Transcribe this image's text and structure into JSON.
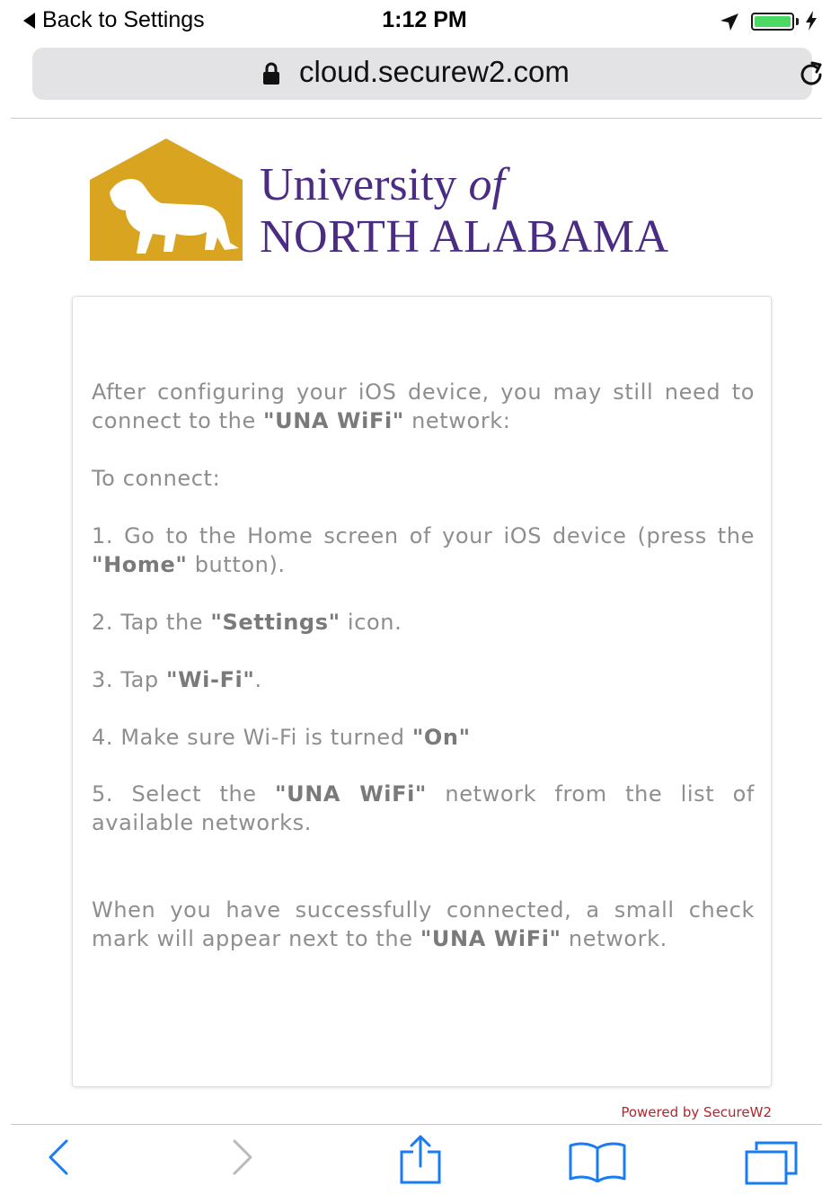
{
  "status_bar": {
    "back_label": "Back to Settings",
    "time": "1:12 PM",
    "battery_color": "#4cd964"
  },
  "browser": {
    "url": "cloud.securew2.com",
    "icons": [
      "lock-icon",
      "reload-icon",
      "back-icon",
      "forward-icon",
      "share-icon",
      "bookmarks-icon",
      "tabs-icon"
    ],
    "accent": "#1a7cf5"
  },
  "logo": {
    "line1_a": "University ",
    "line1_b": "of",
    "line2": "NORTH ALABAMA",
    "brand_gold": "#d9a521",
    "brand_purple": "#4b2c84"
  },
  "card": {
    "intro": {
      "pre": "After configuring your iOS device, you may still need to connect to the ",
      "bold": "\"UNA WiFi\"",
      "post": " network:"
    },
    "to_connect": "To connect:",
    "step1": {
      "pre": "1. Go to the Home screen of your iOS device (press the ",
      "bold": "\"Home\"",
      "post": " button)."
    },
    "step2": {
      "pre": "2. Tap the ",
      "bold": "\"Settings\"",
      "post": " icon."
    },
    "step3": {
      "pre": "3. Tap ",
      "bold": "\"Wi-Fi\"",
      "post": "."
    },
    "step4": {
      "pre": "4. Make sure Wi-Fi is turned ",
      "bold": "\"On\"",
      "post": ""
    },
    "step5": {
      "pre": "5. Select the ",
      "bold": "\"UNA WiFi\"",
      "post": " network from the list of available networks."
    },
    "outro": {
      "pre": "When you have successfully connected, a small check mark will appear next to the ",
      "bold": "\"UNA WiFi\"",
      "post": " network."
    }
  },
  "footer": {
    "powered_by": "Powered by SecureW2"
  }
}
